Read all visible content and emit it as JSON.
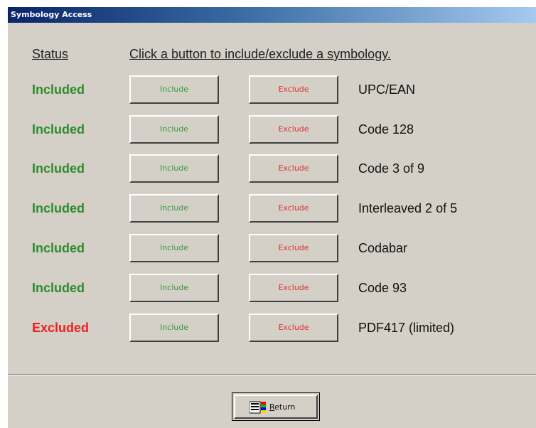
{
  "window": {
    "title": "Symbology Access"
  },
  "header": {
    "status_label": "Status",
    "instruction": "Click a button to include/exclude a symbology."
  },
  "buttons": {
    "include_label": "Include",
    "exclude_label": "Exclude"
  },
  "colors": {
    "included": "#2e8b2e",
    "excluded": "#ee2020",
    "include_button_text": "#3a9a3a",
    "exclude_button_text": "#e03030",
    "title_bar": "#0a246a",
    "dialog_background": "#d4d0c8"
  },
  "symbologies": [
    {
      "status": "Included",
      "name": "UPC/EAN"
    },
    {
      "status": "Included",
      "name": "Code 128"
    },
    {
      "status": "Included",
      "name": "Code 3 of 9"
    },
    {
      "status": "Included",
      "name": "Interleaved 2 of 5"
    },
    {
      "status": "Included",
      "name": "Codabar"
    },
    {
      "status": "Included",
      "name": "Code 93"
    },
    {
      "status": "Excluded",
      "name": "PDF417 (limited)"
    }
  ],
  "footer": {
    "return_label_mnemonic": "R",
    "return_label_rest": "eturn",
    "return_icon": "return-icon"
  }
}
